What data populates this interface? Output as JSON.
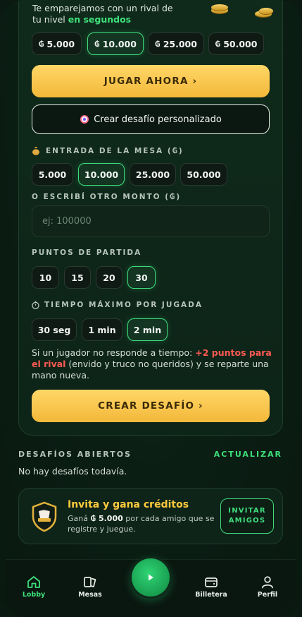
{
  "intro": {
    "line1": "Te emparejamos con un rival de",
    "line2_prefix": "tu nivel",
    "line2_highlight": "en segundos"
  },
  "quick_amounts": [
    {
      "label": "5.000",
      "selected": false
    },
    {
      "label": "10.000",
      "selected": true
    },
    {
      "label": "25.000",
      "selected": false
    },
    {
      "label": "50.000",
      "selected": false
    }
  ],
  "currency_symbol": "₲",
  "play_now_label": "JUGAR AHORA ›",
  "custom_challenge_label": "Crear desafío personalizado",
  "table_entry": {
    "label": "ENTRADA DE LA MESA (₲)",
    "options": [
      {
        "label": "5.000",
        "selected": false
      },
      {
        "label": "10.000",
        "selected": true
      },
      {
        "label": "25.000",
        "selected": false
      },
      {
        "label": "50.000",
        "selected": false
      }
    ]
  },
  "other_amount": {
    "label": "O ESCRIBÍ OTRO MONTO (₲)",
    "placeholder": "ej: 100000",
    "value": ""
  },
  "points": {
    "label": "PUNTOS DE PARTIDA",
    "options": [
      {
        "label": "10",
        "selected": false
      },
      {
        "label": "15",
        "selected": false
      },
      {
        "label": "20",
        "selected": false
      },
      {
        "label": "30",
        "selected": true
      }
    ]
  },
  "turn_time": {
    "label": "TIEMPO MÁXIMO POR JUGADA",
    "options": [
      {
        "label": "30 seg",
        "selected": false
      },
      {
        "label": "1 min",
        "selected": false
      },
      {
        "label": "2 min",
        "selected": true
      }
    ]
  },
  "note": {
    "prefix": "Si un jugador no responde a tiempo:",
    "highlight": "+2 puntos para el rival",
    "suffix": "(envido y truco no queridos) y se reparte una mano nueva."
  },
  "create_challenge_label": "CREAR DESAFÍO ›",
  "open_challenges": {
    "title": "DESAFÍOS ABIERTOS",
    "refresh_label": "ACTUALIZAR",
    "empty_text": "No hay desafíos todavía."
  },
  "invite": {
    "title": "Invita y gana créditos",
    "desc_prefix": "Ganá",
    "desc_amount": "₲ 5.000",
    "desc_suffix": "por cada amigo que se registre y juegue.",
    "button_line1": "INVITAR",
    "button_line2": "AMIGOS"
  },
  "nav": {
    "lobby": "Lobby",
    "tables": "Mesas",
    "wallet": "Billetera",
    "profile": "Perfil"
  },
  "colors": {
    "accent_green": "#3ee07a",
    "gold": "#f3b83a",
    "warning_red": "#ff5a52",
    "invite_title": "#ffcc3f"
  }
}
